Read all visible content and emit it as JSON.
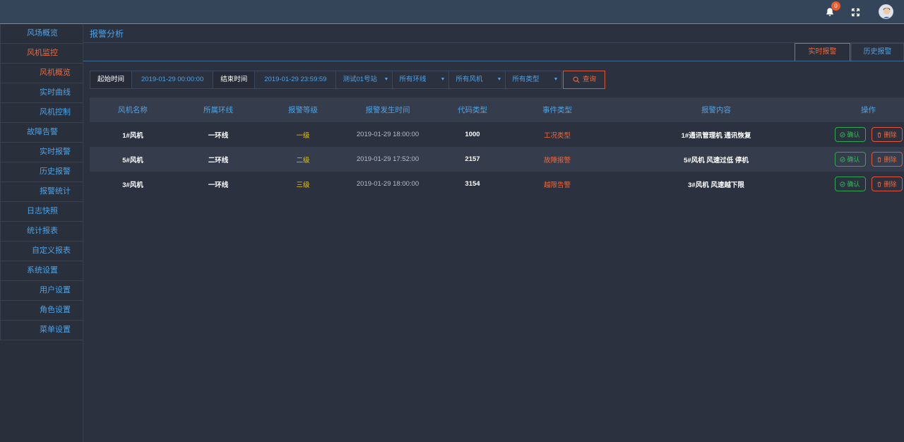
{
  "header": {
    "notification_count": "0",
    "icons": [
      "bell-icon",
      "fullscreen-icon",
      "avatar"
    ]
  },
  "sidebar": {
    "items": [
      {
        "label": "风场概览",
        "level": 1,
        "active": false
      },
      {
        "label": "风机监控",
        "level": 1,
        "active": true
      },
      {
        "label": "风机概览",
        "level": 2,
        "active": true
      },
      {
        "label": "实时曲线",
        "level": 2,
        "active": false
      },
      {
        "label": "风机控制",
        "level": 2,
        "active": false
      },
      {
        "label": "故障告警",
        "level": 1,
        "active": false
      },
      {
        "label": "实时报警",
        "level": 2,
        "active": false
      },
      {
        "label": "历史报警",
        "level": 2,
        "active": false
      },
      {
        "label": "报警统计",
        "level": 2,
        "active": false
      },
      {
        "label": "日志快照",
        "level": 1,
        "active": false
      },
      {
        "label": "统计报表",
        "level": 1,
        "active": false
      },
      {
        "label": "自定义报表",
        "level": 2,
        "active": false
      },
      {
        "label": "系统设置",
        "level": 1,
        "active": false
      },
      {
        "label": "用户设置",
        "level": 2,
        "active": false
      },
      {
        "label": "角色设置",
        "level": 2,
        "active": false
      },
      {
        "label": "菜单设置",
        "level": 2,
        "active": false
      }
    ]
  },
  "page": {
    "title": "报警分析",
    "tabs": {
      "realtime": "实时报警",
      "history": "历史报警"
    }
  },
  "filters": {
    "start_label": "起始时间",
    "start_value": "2019-01-29  00:00:00",
    "end_label": "结束时间",
    "end_value": "2019-01-29  23:59:59",
    "station": "测试01号站",
    "loop": "所有环线",
    "turbine": "所有风机",
    "type": "所有类型",
    "search_label": "查询"
  },
  "table": {
    "headers": [
      "风机名称",
      "所属环线",
      "报警等级",
      "报警发生时间",
      "代码类型",
      "事件类型",
      "报警内容",
      "操作"
    ],
    "rows": [
      {
        "name": "1#风机",
        "loop": "一环线",
        "level": "一级",
        "time": "2019-01-29  18:00:00",
        "code": "1000",
        "event": "工况类型",
        "content": "1#通讯管理机 通讯恢复"
      },
      {
        "name": "5#风机",
        "loop": "二环线",
        "level": "二级",
        "time": "2019-01-29  17:52:00",
        "code": "2157",
        "event": "故障报警",
        "content": "5#风机 风速过低 停机"
      },
      {
        "name": "3#风机",
        "loop": "一环线",
        "level": "三级",
        "time": "2019-01-29  18:00:00",
        "code": "3154",
        "event": "越限告警",
        "content": "3#风机 风速越下限"
      }
    ],
    "actions": {
      "confirm": "确认",
      "delete": "删除"
    }
  },
  "colors": {
    "accent_blue": "#4da3e6",
    "accent_orange": "#f0683a",
    "level_yellow": "#e5c30a",
    "confirm_green": "#2fbf55"
  }
}
